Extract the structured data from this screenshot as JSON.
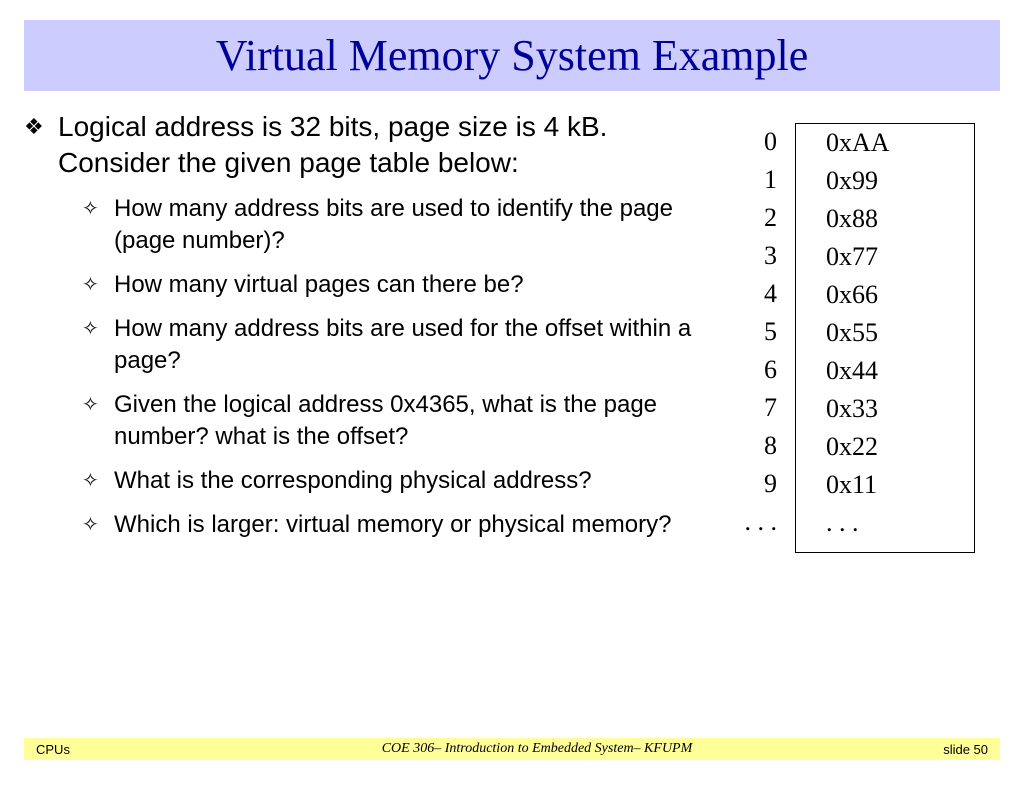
{
  "title": "Virtual Memory System Example",
  "main_bullet": "Logical address is 32 bits, page size is 4 kB. Consider the given page table below:",
  "sub_bullets": [
    "How many address bits are used to identify the page (page number)?",
    "How many virtual pages can there be?",
    "How many address bits are used for the offset within a page?",
    "Given the logical address 0x4365, what is the page number? what is the offset?",
    "What is the corresponding physical address?",
    "Which is larger: virtual memory or physical memory?"
  ],
  "page_table": {
    "indices": [
      "0",
      "1",
      "2",
      "3",
      "4",
      "5",
      "6",
      "7",
      "8",
      "9",
      ". . ."
    ],
    "values": [
      "0xAA",
      "0x99",
      "0x88",
      "0x77",
      "0x66",
      "0x55",
      "0x44",
      "0x33",
      "0x22",
      "0x11",
      ". . ."
    ]
  },
  "footer": {
    "left": "CPUs",
    "center": "COE 306– Introduction to Embedded System– KFUPM",
    "right": "slide 50"
  }
}
